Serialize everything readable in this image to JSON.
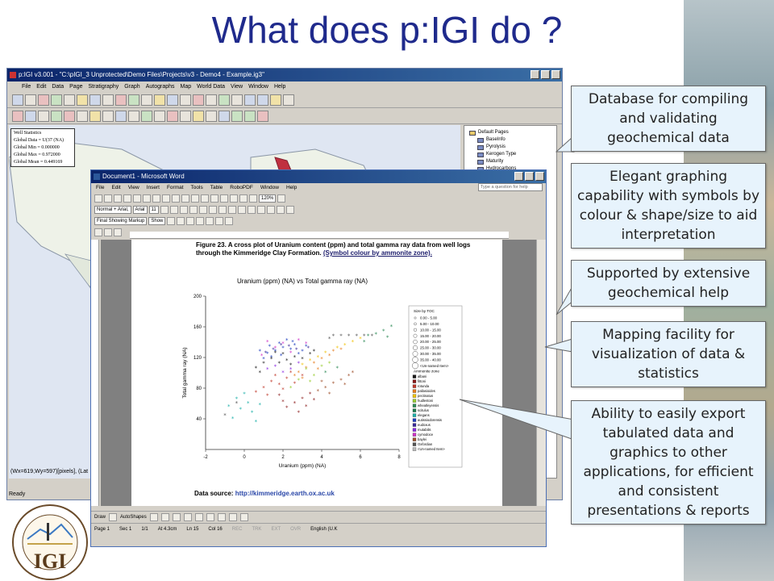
{
  "slide": {
    "title": "What does p:IGI do ?"
  },
  "igi_window": {
    "title": "p:IGI v3.001 - \"C:\\pIGI_3 Unprotected\\Demo Files\\Projects\\v3 - Demo4 - Example.ig3\"",
    "menu": [
      "File",
      "Edit",
      "Data",
      "Page",
      "Stratigraphy",
      "Graph",
      "Autographs",
      "Map",
      "World Data",
      "View",
      "Window",
      "Help"
    ],
    "stats": {
      "heading": "Well Statistics",
      "lines": [
        "Global Data = U(37 (NA)",
        "Global Min = 0.000000",
        "Global Max = 0.972000",
        "Global Mean = 0.449169"
      ]
    },
    "tree": {
      "root": "Default Pages",
      "items": [
        "BaseInfo",
        "Pyrolysis",
        "Kerogen Type",
        "Maturity",
        "Hydrocarbons"
      ]
    },
    "coords": "(Wx=619,Wy=597)[pixels], (Lat",
    "status": "Ready"
  },
  "word_window": {
    "title": "Document1 - Microsoft Word",
    "menu": [
      "File",
      "Edit",
      "View",
      "Insert",
      "Format",
      "Tools",
      "Table",
      "RoboPDF",
      "Window",
      "Help"
    ],
    "ask_placeholder": "Type a question for help",
    "style_box": "Normal + Arial,",
    "font_box": "Arial",
    "size_box": "11",
    "zoom": "120%",
    "markup_box": "Final Showing Markup",
    "show_label": "Show",
    "caption_bold": "Figure 23. A cross plot of Uranium content (ppm) and total gamma ray data from well logs through the Kimmeridge Clay Formation.",
    "caption_link": "(Symbol colour by ammonite zone).",
    "source_label": "Data source:",
    "source_url": "http://kimmeridge.earth.ox.ac.uk",
    "draw_label": "Draw",
    "autoshapes_label": "AutoShapes",
    "status": {
      "page": "Page 1",
      "sec": "Sec 1",
      "pages": "1/1",
      "at": "At 4.3cm",
      "ln": "Ln 15",
      "col": "Col 16",
      "rec": "REC",
      "trk": "TRK",
      "ext": "EXT",
      "ovr": "OVR",
      "lang": "English (U.K"
    }
  },
  "chart_data": {
    "type": "scatter",
    "title": "Uranium (ppm) (NA) vs Total gamma ray (NA)",
    "xlabel": "Uranium (ppm) (NA)",
    "ylabel": "Total gamma ray (NA)",
    "xlim": [
      -2,
      8
    ],
    "ylim": [
      0,
      200
    ],
    "xticks": [
      -2,
      0,
      2,
      4,
      6,
      8
    ],
    "yticks": [
      40,
      80,
      120,
      160,
      200
    ],
    "legend_size_title": "Size by TOC",
    "legend_size": [
      "0.00 - 5.00",
      "5.00 - 10.00",
      "10.00 - 15.00",
      "15.00 - 20.00",
      "20.00 - 25.00",
      "25.00 - 30.00",
      "30.00 - 35.00",
      "35.00 - 40.00",
      "<Un-named Item>"
    ],
    "legend_zone_title": "Ammonite zone",
    "legend_zone": [
      {
        "name": "albani",
        "color": "#1a1a1a"
      },
      {
        "name": "fittoni",
        "color": "#8b1a1a"
      },
      {
        "name": "rotunda",
        "color": "#c0392b"
      },
      {
        "name": "pallasioides",
        "color": "#e67e22"
      },
      {
        "name": "pectinatus",
        "color": "#f1c40f"
      },
      {
        "name": "hudlestoni",
        "color": "#9acd32"
      },
      {
        "name": "wheatleyensis",
        "color": "#2e8b57"
      },
      {
        "name": "scitulus",
        "color": "#1e7f4f"
      },
      {
        "name": "elegans",
        "color": "#20b2aa"
      },
      {
        "name": "autissiodorensis",
        "color": "#1f3fbf"
      },
      {
        "name": "eudoxus",
        "color": "#3a2a9a"
      },
      {
        "name": "mutabilis",
        "color": "#8a2be2"
      },
      {
        "name": "cymodoce",
        "color": "#d036c8"
      },
      {
        "name": "baylei",
        "color": "#a0522d"
      },
      {
        "name": "Oxfordian",
        "color": "#555555"
      },
      {
        "name": "<Un-named Item>",
        "color": "#bbbbbb"
      }
    ],
    "series": [
      {
        "color": "#1f3fbf",
        "points": [
          [
            1.2,
            125
          ],
          [
            1.6,
            128
          ],
          [
            2.0,
            132
          ],
          [
            2.4,
            130
          ],
          [
            1.8,
            138
          ],
          [
            1.4,
            120
          ],
          [
            2.6,
            136
          ],
          [
            3.0,
            128
          ],
          [
            2.2,
            142
          ],
          [
            1.0,
            118
          ],
          [
            2.8,
            124
          ],
          [
            3.2,
            134
          ],
          [
            1.9,
            122
          ],
          [
            2.5,
            140
          ],
          [
            0.8,
            128
          ],
          [
            1.3,
            134
          ]
        ]
      },
      {
        "color": "#1a1a1a",
        "points": [
          [
            1.4,
            118
          ],
          [
            1.8,
            112
          ],
          [
            2.2,
            116
          ],
          [
            2.6,
            120
          ],
          [
            3.0,
            118
          ],
          [
            1.0,
            112
          ],
          [
            0.6,
            106
          ],
          [
            3.4,
            124
          ],
          [
            2.4,
            110
          ],
          [
            1.6,
            126
          ],
          [
            2.0,
            124
          ],
          [
            0.8,
            100
          ],
          [
            3.6,
            128
          ]
        ]
      },
      {
        "color": "#d036c8",
        "points": [
          [
            1.6,
            132
          ],
          [
            2.0,
            138
          ],
          [
            2.4,
            126
          ],
          [
            1.2,
            140
          ],
          [
            2.8,
            142
          ],
          [
            3.2,
            138
          ],
          [
            0.9,
            122
          ]
        ]
      },
      {
        "color": "#3a2a9a",
        "points": [
          [
            1.5,
            130
          ],
          [
            1.9,
            136
          ],
          [
            2.3,
            134
          ],
          [
            2.7,
            130
          ],
          [
            1.1,
            126
          ],
          [
            3.3,
            132
          ]
        ]
      },
      {
        "color": "#c0392b",
        "points": [
          [
            1.0,
            80
          ],
          [
            1.4,
            88
          ],
          [
            1.8,
            84
          ],
          [
            2.2,
            92
          ],
          [
            2.6,
            86
          ],
          [
            0.6,
            74
          ],
          [
            1.6,
            96
          ],
          [
            2.0,
            78
          ],
          [
            2.4,
            100
          ],
          [
            3.0,
            96
          ],
          [
            1.2,
            70
          ]
        ]
      },
      {
        "color": "#e67e22",
        "points": [
          [
            2.8,
            100
          ],
          [
            3.2,
            106
          ],
          [
            3.6,
            112
          ],
          [
            4.0,
            118
          ],
          [
            4.4,
            122
          ],
          [
            3.0,
            92
          ],
          [
            3.8,
            104
          ],
          [
            4.6,
            128
          ],
          [
            5.0,
            130
          ],
          [
            2.6,
            96
          ]
        ]
      },
      {
        "color": "#f1c40f",
        "points": [
          [
            3.4,
            116
          ],
          [
            3.8,
            120
          ],
          [
            4.2,
            126
          ],
          [
            4.8,
            132
          ],
          [
            5.2,
            136
          ],
          [
            5.6,
            140
          ],
          [
            6.0,
            144
          ],
          [
            3.0,
            110
          ]
        ]
      },
      {
        "color": "#9acd32",
        "points": [
          [
            3.2,
            104
          ],
          [
            3.6,
            96
          ],
          [
            4.0,
            108
          ],
          [
            2.8,
            90
          ],
          [
            4.4,
            112
          ],
          [
            3.4,
            88
          ],
          [
            2.4,
            80
          ]
        ]
      },
      {
        "color": "#2e8b57",
        "points": [
          [
            6.4,
            148
          ],
          [
            6.8,
            150
          ],
          [
            7.2,
            154
          ],
          [
            7.6,
            160
          ],
          [
            6.2,
            140
          ],
          [
            4.2,
            100
          ],
          [
            4.8,
            106
          ],
          [
            7.4,
            146
          ]
        ]
      },
      {
        "color": "#20b2aa",
        "points": [
          [
            -0.6,
            40
          ],
          [
            -0.2,
            52
          ],
          [
            0.2,
            60
          ],
          [
            0.4,
            48
          ],
          [
            -0.4,
            66
          ],
          [
            0.0,
            72
          ],
          [
            0.8,
            58
          ],
          [
            0.6,
            36
          ],
          [
            -0.8,
            56
          ]
        ]
      },
      {
        "color": "#a0522d",
        "points": [
          [
            4.2,
            80
          ],
          [
            4.6,
            86
          ],
          [
            5.0,
            90
          ],
          [
            5.4,
            96
          ],
          [
            3.8,
            76
          ],
          [
            4.4,
            72
          ],
          [
            5.2,
            84
          ],
          [
            4.0,
            88
          ],
          [
            5.6,
            100
          ]
        ]
      },
      {
        "color": "#8b1a1a",
        "points": [
          [
            2.6,
            60
          ],
          [
            3.0,
            66
          ],
          [
            3.4,
            72
          ],
          [
            2.2,
            54
          ],
          [
            3.6,
            64
          ],
          [
            2.8,
            48
          ],
          [
            3.2,
            56
          ],
          [
            2.0,
            62
          ],
          [
            1.8,
            70
          ]
        ]
      },
      {
        "color": "#8a2be2",
        "points": [
          [
            2.0,
            100
          ],
          [
            2.4,
            104
          ],
          [
            1.6,
            108
          ],
          [
            2.8,
            112
          ],
          [
            1.2,
            104
          ]
        ]
      },
      {
        "color": "#555555",
        "points": [
          [
            4.6,
            148
          ],
          [
            5.0,
            148
          ],
          [
            5.4,
            148
          ],
          [
            5.8,
            148
          ],
          [
            6.2,
            148
          ],
          [
            6.6,
            148
          ],
          [
            4.4,
            144
          ],
          [
            -0.4,
            60
          ],
          [
            -1.0,
            44
          ]
        ]
      }
    ]
  },
  "callouts": [
    "Database for compiling and validating geochemical data",
    "Elegant graphing capability with symbols by colour & shape/size to aid interpretation",
    "Supported by extensive geochemical help",
    "Mapping facility for visualization of data & statistics",
    "Ability to easily export tabulated data and graphics to other applications, for efficient and consistent presentations & reports"
  ],
  "logo": {
    "text": "IGI",
    "ring_text": "INTEGRATED GEOCHEMICAL INTERPRETATION"
  },
  "colors": {
    "title": "#1f2a8c",
    "callout_fill": "#e7f3fc",
    "callout_border": "#666666",
    "xp_titlebar": "#0a246a"
  }
}
